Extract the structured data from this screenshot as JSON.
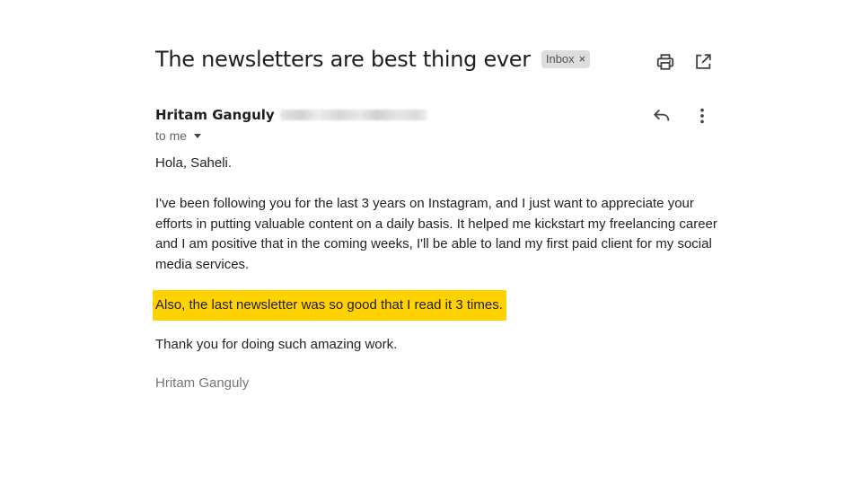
{
  "email": {
    "subject": "The newsletters are best thing ever",
    "label": "Inbox",
    "label_remove": "×",
    "sender_name": "Hritam Ganguly",
    "recipient": "to me",
    "greeting": "Hola, Saheli.",
    "paragraph1": "I've been following you for the last 3 years on Instagram, and I just want to appreciate your efforts in putting valuable content on a daily basis. It helped me kickstart my freelancing career and I am positive that in the coming weeks, I'll be able to land my first paid client for my social media services.",
    "highlighted_line": "Also, the last newsletter was so good that I read it 3 times.",
    "thanks_line": "Thank you for doing such amazing work.",
    "signature": "Hritam Ganguly"
  },
  "toolbar": {
    "print_icon": "print-icon",
    "popout_icon": "open-in-new-window-icon",
    "reply_icon": "reply-icon",
    "more_icon": "more-vertical-icon"
  },
  "colors": {
    "highlight": "#ffd200",
    "label_chip_bg": "#dddddd",
    "text": "#222222",
    "muted": "#5f6368"
  }
}
